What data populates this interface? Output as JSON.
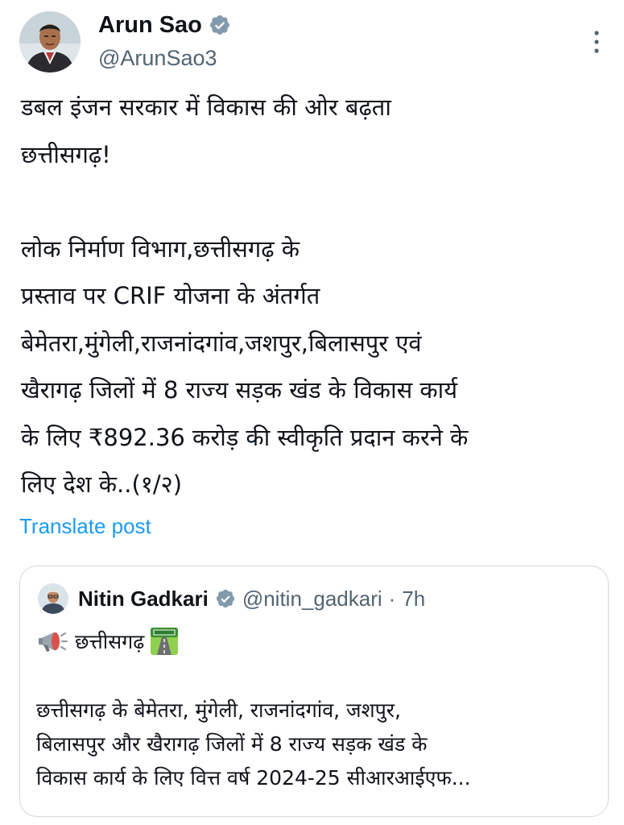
{
  "author": {
    "display_name": "Arun Sao",
    "handle": "@ArunSao3",
    "avatar_icon": "profile-photo",
    "verified_icon": "verified-badge-icon"
  },
  "post": {
    "text": "डबल इंजन सरकार में विकास की ओर बढ़ता\nछत्तीसगढ़!\n\nलोक निर्माण विभाग,छत्तीसगढ़ के\nप्रस्ताव पर CRIF योजना के अंतर्गत\nबेमेतरा,मुंगेली,राजनांदगांव,जशपुर,बिलासपुर एवं\nखैरागढ़ जिलों में 8 राज्य सड़क खंड के विकास कार्य\nके लिए ₹892.36 करोड़ की स्वीकृति प्रदान करने के\nलिए देश के..(१/२)",
    "translate_label": "Translate post"
  },
  "quoted_post": {
    "display_name": "Nitin Gadkari",
    "handle": "@nitin_gadkari",
    "separator": "·",
    "time": "7h",
    "title": "छत्तीसगढ़",
    "title_icons": [
      "megaphone-icon",
      "motorway-icon"
    ],
    "body": "छत्तीसगढ़ के बेमेतरा, मुंगेली, राजनांदगांव, जशपुर,\nबिलासपुर और खैरागढ़ जिलों में 8 राज्य सड़क खंड के\nविकास कार्य के लिए वित्त वर्ष 2024-25 सीआरआईएफ..."
  },
  "colors": {
    "text": "#0f1419",
    "secondary": "#536471",
    "link": "#1d9bf0",
    "verified": "#829aab",
    "border": "#cfd9de"
  }
}
